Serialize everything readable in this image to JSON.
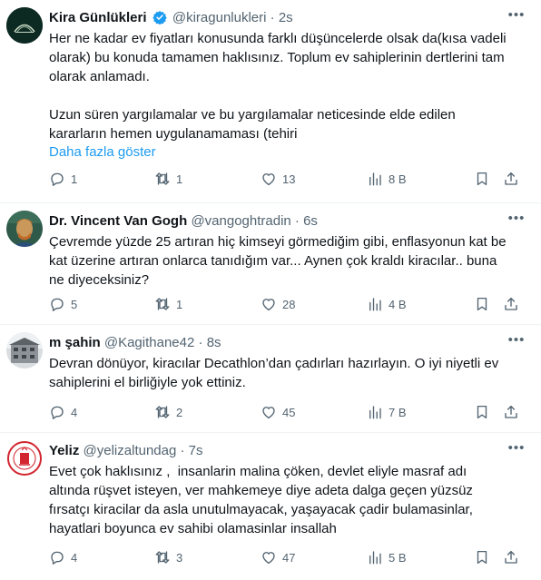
{
  "tweets": [
    {
      "name": "Kira Günlükleri",
      "verified": true,
      "handle": "@kiragunlukleri",
      "dot": "·",
      "time": "2s",
      "text": "Her ne kadar ev fiyatları konusunda farklı düşüncelerde olsak da(kısa vadeli\nolarak) bu konuda tamamen haklısınız. Toplum ev sahiplerinin dertlerini tam\nolarak anlamadı.\n\nUzun süren yargılamalar ve bu yargılamalar neticesinde elde edilen\nkararların hemen uygulanamaması (tehiri",
      "show_more": "Daha fazla göster",
      "replies": "1",
      "retweets": "1",
      "likes": "13",
      "views": "8 B"
    },
    {
      "name": "Dr. Vincent Van Gogh",
      "handle": "@vangoghtradin",
      "dot": "·",
      "time": "6s",
      "text": "Çevremde yüzde 25 artıran hiç kimseyi görmediğim gibi, enflasyonun kat be\nkat üzerine artıran onlarca tanıdığım var... Aynen çok kraldı kiracılar.. buna\nne diyeceksiniz?",
      "replies": "5",
      "retweets": "1",
      "likes": "28",
      "views": "4 B"
    },
    {
      "name": "m şahin",
      "handle": "@Kagithane42",
      "dot": "·",
      "time": "8s",
      "text": "Devran dönüyor, kiracılar Decathlon’dan çadırları hazırlayın. O iyi niyetli ev\nsahiplerini el birliğiyle yok ettiniz.",
      "replies": "4",
      "retweets": "2",
      "likes": "45",
      "views": "7 B"
    },
    {
      "name": "Yeliz",
      "handle": "@yelizaltundag",
      "dot": "·",
      "time": "7s",
      "text": "Evet çok haklısınız ,  insanlarin malina çöken, devlet eliyle masraf adı\naltında rüşvet isteyen, ver mahkemeye diye adeta dalga geçen yüzsüz\nfırsatçı kiracilar da asla unutulmayacak, yaşayacak çadir bulamasinlar,\nhayatlari boyunca ev sahibi olamasinlar insallah",
      "replies": "4",
      "retweets": "3",
      "likes": "47",
      "views": "5 B"
    }
  ],
  "icons": {
    "reply": "reply-icon",
    "retweet": "retweet-icon",
    "like": "heart-icon",
    "views": "views-icon",
    "bookmark": "bookmark-icon",
    "share": "share-icon",
    "more": "more-icon",
    "verified": "verified-badge-icon"
  },
  "colors": {
    "text": "#0f1419",
    "secondary": "#536471",
    "link": "#1d9bf0",
    "divider": "#eff3f4"
  }
}
